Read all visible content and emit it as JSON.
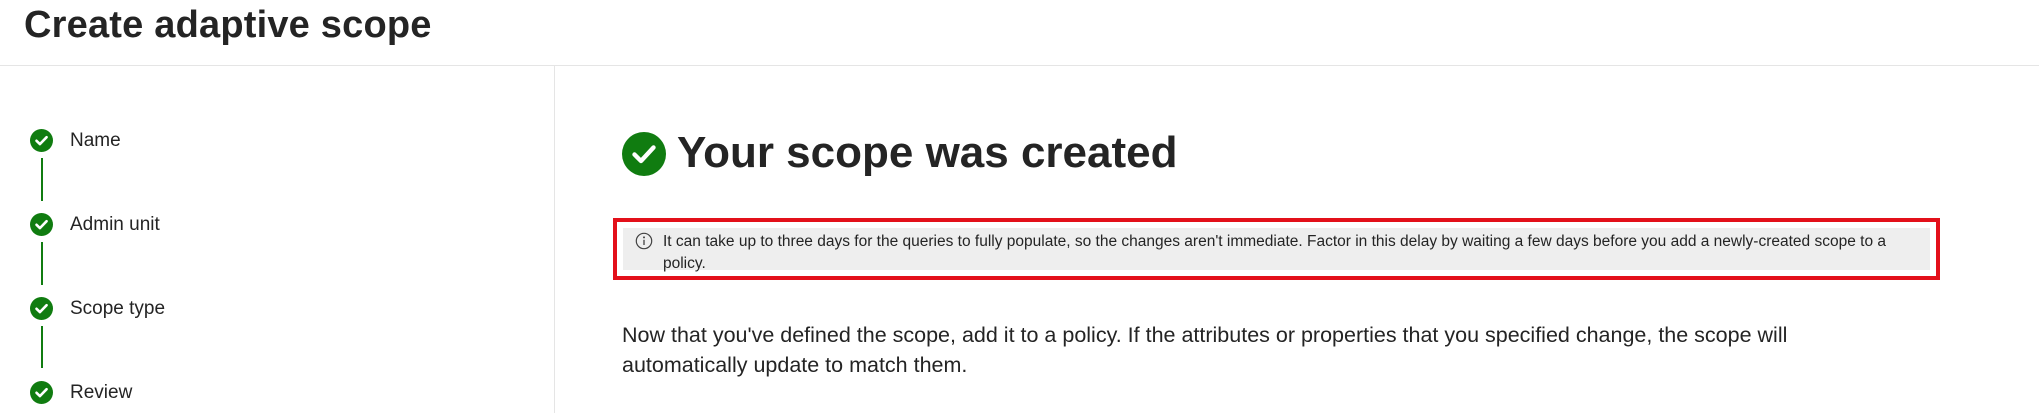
{
  "header": {
    "title": "Create adaptive scope"
  },
  "wizard": {
    "steps": [
      {
        "label": "Name",
        "status": "completed"
      },
      {
        "label": "Admin unit",
        "status": "completed"
      },
      {
        "label": "Scope type",
        "status": "completed"
      },
      {
        "label": "Review",
        "status": "completed"
      }
    ]
  },
  "main": {
    "title": "Your scope was created",
    "info_message": "It can take up to three days for the queries to fully populate, so the changes aren't immediate. Factor in this delay by waiting a few days before you add a newly-created scope to a policy.",
    "body": "Now that you've defined the scope, add it to a policy. If the attributes or properties that you specified change, the scope will automatically update to match them."
  },
  "colors": {
    "success": "#107c10",
    "highlight_border": "#e3101a",
    "info_background": "#eeeeee",
    "text": "#242424"
  },
  "icons": {
    "step_status": "checkmark-circle-icon",
    "result": "checkmark-circle-icon",
    "info": "info-icon"
  }
}
